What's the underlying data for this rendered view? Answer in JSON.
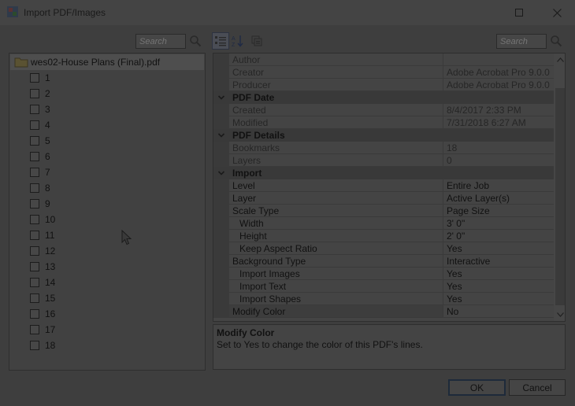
{
  "window": {
    "title": "Import PDF/Images",
    "maximize_icon": "maximize-icon",
    "close_icon": "close-icon"
  },
  "left_panel": {
    "search_placeholder": "Search",
    "tree_root_label": "wes02-House Plans (Final).pdf",
    "pages": [
      "1",
      "2",
      "3",
      "4",
      "5",
      "6",
      "7",
      "8",
      "9",
      "10",
      "11",
      "12",
      "13",
      "14",
      "15",
      "16",
      "17",
      "18"
    ]
  },
  "property_grid": {
    "search_placeholder": "Search",
    "toolbar_icons": [
      "categorized-icon",
      "alphabetical-icon",
      "property-pages-icon"
    ],
    "rows": [
      {
        "type": "prop",
        "name": "Author",
        "value": "",
        "readonly": true
      },
      {
        "type": "prop",
        "name": "Creator",
        "value": "Adobe Acrobat Pro 9.0.0",
        "readonly": true
      },
      {
        "type": "prop",
        "name": "Producer",
        "value": "Adobe Acrobat Pro 9.0.0",
        "readonly": true
      },
      {
        "type": "category",
        "name": "PDF Date"
      },
      {
        "type": "prop",
        "name": "Created",
        "value": "8/4/2017 2:33 PM",
        "readonly": true
      },
      {
        "type": "prop",
        "name": "Modified",
        "value": "7/31/2018 6:27 AM",
        "readonly": true
      },
      {
        "type": "category",
        "name": "PDF Details"
      },
      {
        "type": "prop",
        "name": "Bookmarks",
        "value": "18",
        "readonly": true
      },
      {
        "type": "prop",
        "name": "Layers",
        "value": "0",
        "readonly": true
      },
      {
        "type": "category",
        "name": "Import"
      },
      {
        "type": "prop",
        "name": "Level",
        "value": "Entire Job"
      },
      {
        "type": "prop",
        "name": "Layer",
        "value": "Active Layer(s)"
      },
      {
        "type": "prop",
        "name": "Scale Type",
        "value": "Page Size"
      },
      {
        "type": "prop",
        "name": "Width",
        "value": "3' 0\"",
        "indent": true
      },
      {
        "type": "prop",
        "name": "Height",
        "value": "2' 0\"",
        "indent": true
      },
      {
        "type": "prop",
        "name": "Keep Aspect Ratio",
        "value": "Yes",
        "indent": true
      },
      {
        "type": "prop",
        "name": "Background Type",
        "value": "Interactive"
      },
      {
        "type": "prop",
        "name": "Import Images",
        "value": "Yes",
        "indent": true
      },
      {
        "type": "prop",
        "name": "Import Text",
        "value": "Yes",
        "indent": true
      },
      {
        "type": "prop",
        "name": "Import Shapes",
        "value": "Yes",
        "indent": true
      },
      {
        "type": "prop",
        "name": "Modify Color",
        "value": "No",
        "selected": true
      }
    ]
  },
  "description": {
    "title": "Modify Color",
    "text": "Set to Yes to change the color of this PDF's lines."
  },
  "buttons": {
    "ok": "OK",
    "cancel": "Cancel"
  }
}
